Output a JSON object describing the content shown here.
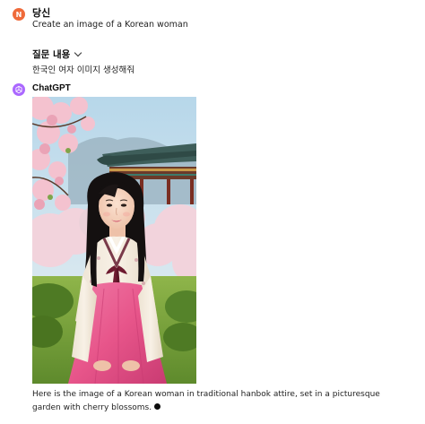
{
  "user": {
    "avatar_initial": "N",
    "name": "당신",
    "message": "Create an image of a Korean woman"
  },
  "edit": {
    "label": "질문 내용",
    "text": "한국인 여자 이미지 생성해줘"
  },
  "assistant": {
    "name": "ChatGPT",
    "image_icon": "korean-woman-hanbok-image",
    "reply": "Here is the image of a Korean woman in traditional hanbok attire, set in a picturesque garden with cherry blossoms."
  },
  "colors": {
    "user_avatar": "#ef6a3a",
    "gpt_avatar": "#ab68ff",
    "hanbok_skirt": "#e7558a",
    "hanbok_ribbon": "#6e1b30"
  }
}
